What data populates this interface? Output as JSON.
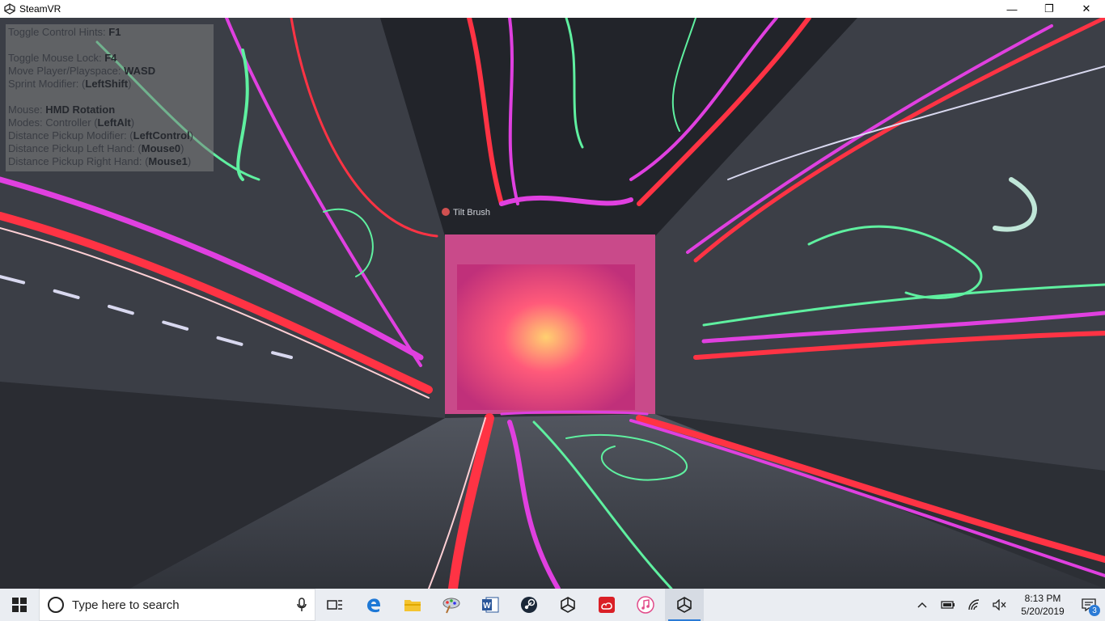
{
  "window": {
    "title": "SteamVR",
    "minimize": "—",
    "maximize": "❐",
    "close": "✕"
  },
  "scene": {
    "logo_text": "Tilt Brush"
  },
  "hints": [
    {
      "label": "Toggle Control Hints: ",
      "key": "F1"
    },
    {
      "label": "Toggle Mouse Lock: ",
      "key": "F4"
    },
    {
      "label": "Move Player/Playspace: ",
      "key": "WASD"
    },
    {
      "label": "Sprint Modifier: (",
      "key": "LeftShift",
      "suffix": ")"
    },
    {
      "label": "Mouse: ",
      "key": "HMD Rotation"
    },
    {
      "label": "Modes: Controller (",
      "key": "LeftAlt",
      "suffix": ")"
    },
    {
      "label": "Distance Pickup Modifier: (",
      "key": "LeftControl",
      "suffix": ")"
    },
    {
      "label": "Distance Pickup Left Hand: (",
      "key": "Mouse0",
      "suffix": ")"
    },
    {
      "label": "Distance Pickup Right Hand: (",
      "key": "Mouse1",
      "suffix": ")"
    }
  ],
  "taskbar": {
    "search_placeholder": "Type here to search",
    "time": "8:13 PM",
    "date": "5/20/2019",
    "notification_count": "3"
  },
  "colors": {
    "magenta": "#e040e0",
    "red": "#ff3344",
    "green": "#5ff0a0",
    "wall": "#3a3d45",
    "accent": "#2b7bd6"
  }
}
